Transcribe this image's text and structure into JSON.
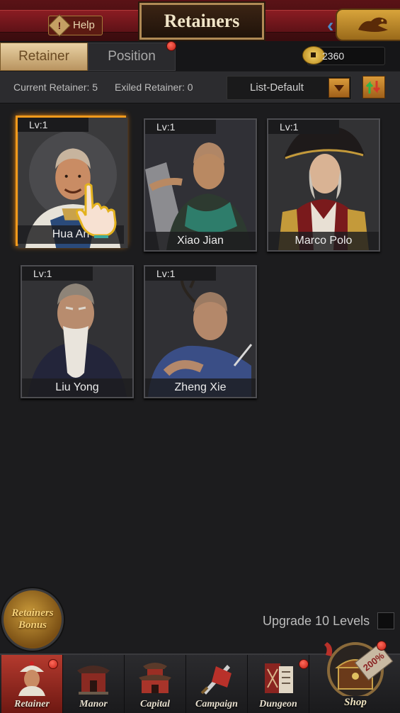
{
  "header": {
    "help_label": "Help",
    "title": "Retainers",
    "back_icon": "dragon-back-icon"
  },
  "tabs": [
    {
      "label": "Retainer",
      "active": true,
      "has_notification": false
    },
    {
      "label": "Position",
      "active": false,
      "has_notification": true
    }
  ],
  "currency": {
    "icon": "coin-icon",
    "value": "2360"
  },
  "info": {
    "current_retainer": "Current Retainer: 5",
    "exiled_retainer": "Exiled Retainer: 0",
    "sort_selected": "List-Default"
  },
  "retainers": [
    {
      "level": "Lv:1",
      "name": "Hua An",
      "selected": true
    },
    {
      "level": "Lv:1",
      "name": "Xiao Jian",
      "selected": false
    },
    {
      "level": "Lv:1",
      "name": "Marco Polo",
      "selected": false
    },
    {
      "level": "Lv:1",
      "name": "Liu Yong",
      "selected": false
    },
    {
      "level": "Lv:1",
      "name": "Zheng Xie",
      "selected": false
    }
  ],
  "bonus_button": {
    "line1": "Retainers",
    "line2": "Bonus"
  },
  "upgrade": {
    "label": "Upgrade 10 Levels",
    "checked": false
  },
  "nav": [
    {
      "label": "Retainer",
      "icon": "retainer-icon",
      "active": true,
      "has_notification": true
    },
    {
      "label": "Manor",
      "icon": "manor-icon",
      "active": false,
      "has_notification": false
    },
    {
      "label": "Capital",
      "icon": "capital-icon",
      "active": false,
      "has_notification": false
    },
    {
      "label": "Campaign",
      "icon": "campaign-icon",
      "active": false,
      "has_notification": false
    },
    {
      "label": "Dungeon",
      "icon": "dungeon-icon",
      "active": false,
      "has_notification": true
    },
    {
      "label": "Shop",
      "icon": "shop-icon",
      "active": false,
      "has_notification": true,
      "badge": "200%"
    }
  ],
  "colors": {
    "accent_orange": "#f29a1c",
    "header_red": "#8a1c22",
    "gold": "#d8a43b",
    "background": "#1c1c1e"
  }
}
